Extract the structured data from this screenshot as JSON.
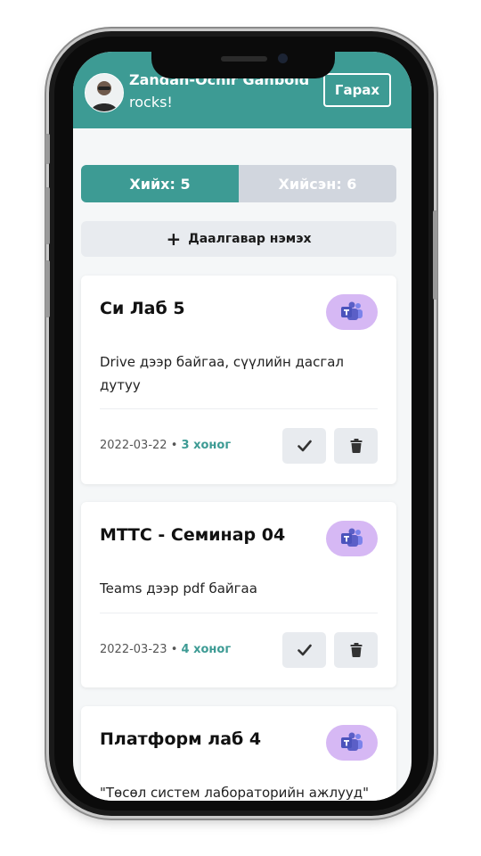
{
  "header": {
    "user_name": "Zandan-Ochir Ganbold",
    "user_subtitle": "rocks!",
    "logout_label": "Гарах"
  },
  "tabs": [
    {
      "label": "Хийх: 5",
      "active": true
    },
    {
      "label": "Хийсэн: 6",
      "active": false
    }
  ],
  "add_task_label": "Даалгавар нэмэх",
  "tasks": [
    {
      "title": "Си Лаб 5",
      "description": "Drive дээр байгаа, сүүлийн дасгал дутуу",
      "date": "2022-03-22",
      "days_left": "3 хоног",
      "icon": "teams-icon"
    },
    {
      "title": "МТТС - Семинар 04",
      "description": "Teams дээр pdf байгаа",
      "date": "2022-03-23",
      "days_left": "4 хоног",
      "icon": "teams-icon"
    },
    {
      "title": "Платформ лаб 4",
      "description": "\"Төсөл систем лабораторийн ажлууд\"",
      "date": "",
      "days_left": "",
      "icon": "teams-icon"
    }
  ],
  "colors": {
    "accent": "#3d9b94",
    "tab_inactive": "#d1d6de",
    "teams_badge": "#d6b8f4",
    "teams_purple": "#5b5fc7"
  }
}
